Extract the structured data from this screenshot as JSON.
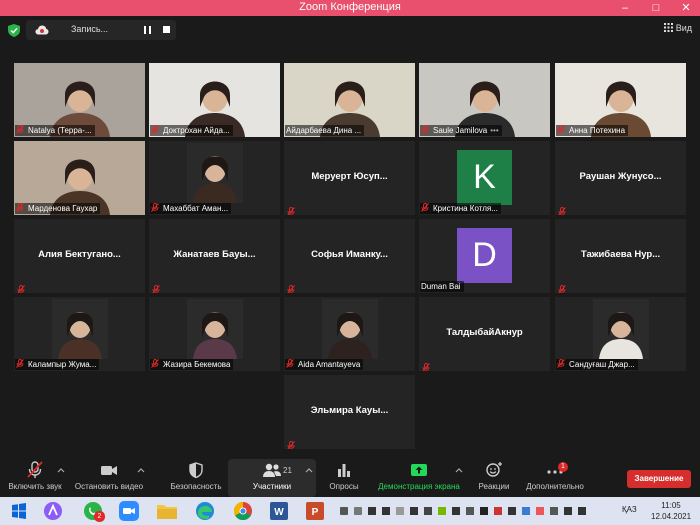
{
  "window": {
    "title": "Zoom Конференция",
    "minimize": "–",
    "maximize": "□",
    "close": "✕"
  },
  "recording": {
    "label": "Запись..."
  },
  "view": {
    "label": "Вид"
  },
  "participants": [
    {
      "name": "Natalya (Терра-...",
      "video": true,
      "muted": true,
      "active": false
    },
    {
      "name": "Доктрохан Айда...",
      "video": true,
      "muted": true,
      "active": false
    },
    {
      "name": "Айдарбаева Дина ...",
      "video": true,
      "muted": false,
      "active": true
    },
    {
      "name": "Saule Jamilova",
      "video": true,
      "muted": true,
      "active": false,
      "more": "•••"
    },
    {
      "name": "Анна Потехина",
      "video": true,
      "muted": true,
      "active": false
    },
    {
      "name": "Марденова Гаухар",
      "video": true,
      "muted": true,
      "active": false
    },
    {
      "name": "Махаббат Аман...",
      "video": true,
      "muted": true,
      "active": false
    },
    {
      "name": "Меруерт  Юсуп...",
      "video": false,
      "muted": true,
      "active": false
    },
    {
      "name": "Кристина Котля...",
      "video": false,
      "muted": true,
      "active": false,
      "avatar_letter": "K",
      "avatar_color": "#1e7f47"
    },
    {
      "name": "Раушан  Жунусо...",
      "video": false,
      "muted": true,
      "active": false
    },
    {
      "name": "Алия  Бектугано...",
      "video": false,
      "muted": true,
      "active": false
    },
    {
      "name": "Жанатаев  Бауы...",
      "video": false,
      "muted": true,
      "active": false
    },
    {
      "name": "Софья  Иманку...",
      "video": false,
      "muted": true,
      "active": false
    },
    {
      "name": "Duman Bai",
      "video": false,
      "muted": false,
      "active": false,
      "avatar_letter": "D",
      "avatar_color": "#7b52c6"
    },
    {
      "name": "Тажибаева  Нур...",
      "video": false,
      "muted": true,
      "active": false
    },
    {
      "name": "Калампыр Жума...",
      "video": true,
      "muted": true,
      "active": false
    },
    {
      "name": "Жазира Бекемова",
      "video": true,
      "muted": true,
      "active": false
    },
    {
      "name": "Aida Amantayeva",
      "video": true,
      "muted": true,
      "active": false
    },
    {
      "name": "ТалдыбайАкнур",
      "video": false,
      "muted": true,
      "active": false
    },
    {
      "name": "Сандуғаш Джар...",
      "video": true,
      "muted": true,
      "active": false
    },
    {
      "name": "Эльмира  Кауы...",
      "video": false,
      "muted": true,
      "active": false
    }
  ],
  "toolbar": {
    "unmute": "Включить звук",
    "stop_video": "Остановить видео",
    "security": "Безопасность",
    "participants": "Участники",
    "participants_count": "21",
    "polls": "Опросы",
    "share_screen": "Демонстрация экрана",
    "reactions": "Реакции",
    "more": "Дополнительно",
    "more_badge": "1",
    "end": "Завершение",
    "share_color": "#23d959",
    "end_color": "#d62d2d"
  },
  "taskbar": {
    "whatsapp_badge": "2",
    "word_label": "W",
    "ppt_label": "P",
    "lang": "ҚАЗ",
    "time": "11:05",
    "date": "12.04.2021"
  },
  "colors": {
    "titlebar": "#e8506d",
    "active_outline": "#b8e03c"
  }
}
